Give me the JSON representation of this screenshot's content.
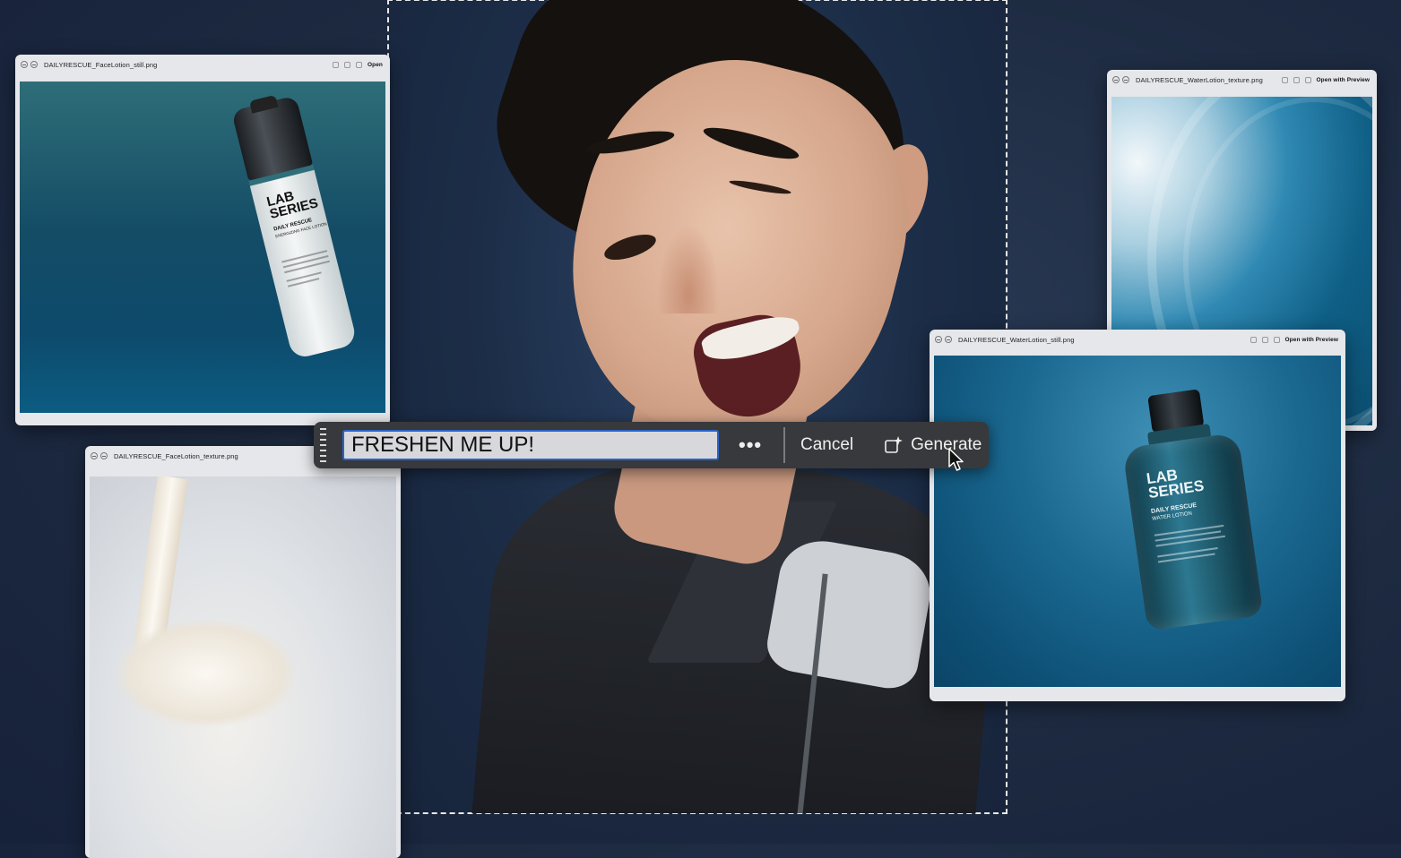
{
  "windows": {
    "face_still": {
      "filename": "DAILYRESCUE_FaceLotion_still.png",
      "action": "Open"
    },
    "face_texture": {
      "filename": "DAILYRESCUE_FaceLotion_texture.png"
    },
    "water_texture": {
      "filename": "DAILYRESCUE_WaterLotion_texture.png",
      "action": "Open with Preview"
    },
    "water_still": {
      "filename": "DAILYRESCUE_WaterLotion_still.png",
      "action": "Open with Preview"
    }
  },
  "products": {
    "face_lotion": {
      "brand_line1": "LAB",
      "brand_line2": "SERIES",
      "name": "DAILY RESCUE",
      "sub": "ENERGIZING FACE LOTION"
    },
    "water_lotion": {
      "brand_line1": "LAB",
      "brand_line2": "SERIES",
      "name": "DAILY RESCUE",
      "sub": "WATER LOTION"
    }
  },
  "prompt_bar": {
    "input_value": "FRESHEN ME UP!",
    "more_label": "•••",
    "cancel_label": "Cancel",
    "generate_label": "Generate"
  },
  "colors": {
    "selection_border": "#e8e8e8",
    "input_focus": "#2a63c7",
    "toolbar_bg": "#38393c"
  },
  "icons": {
    "grip": "drag-handle-icon",
    "generate": "sparkle-generate-icon",
    "cursor": "mouse-pointer-icon"
  }
}
